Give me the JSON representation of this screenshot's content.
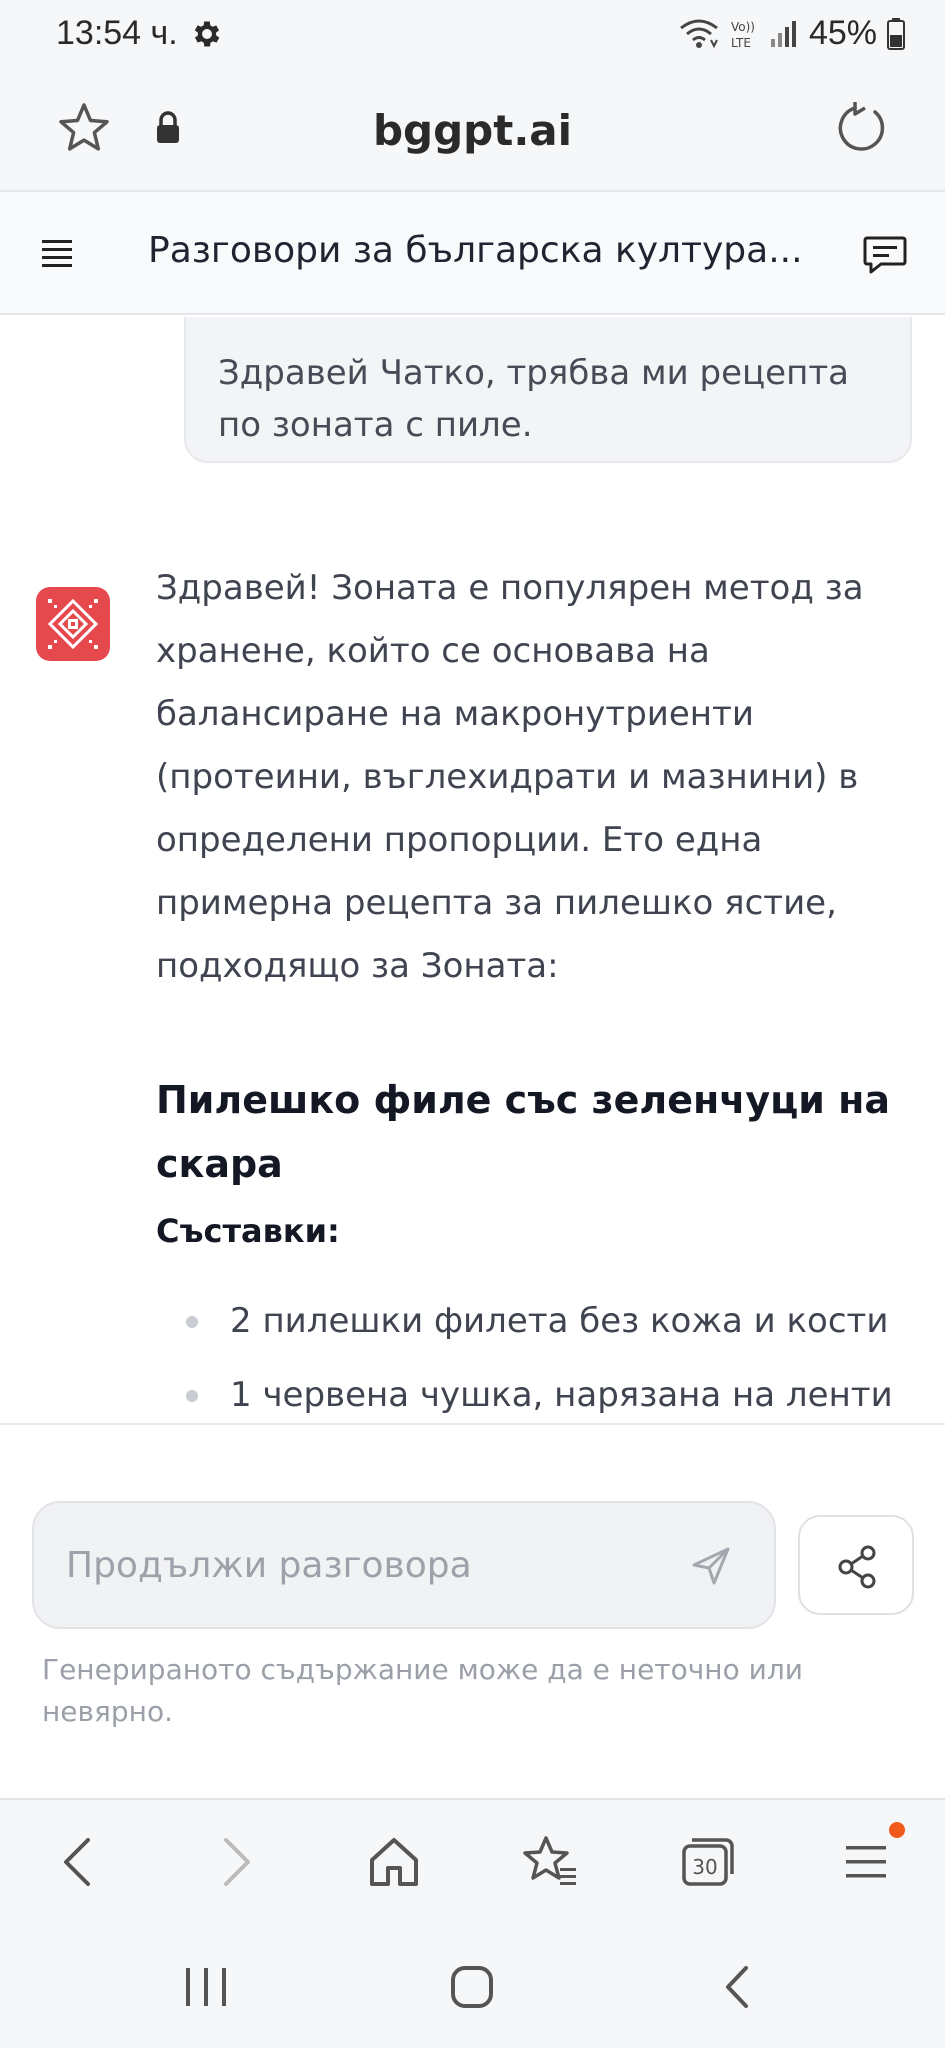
{
  "status_bar": {
    "time": "13:54 ч.",
    "battery": "45%",
    "icons": [
      "gear-icon",
      "wifi-icon",
      "volte-icon",
      "signal-icon",
      "battery-icon"
    ]
  },
  "address_bar": {
    "url": "bggpt.ai",
    "icons": [
      "star-icon",
      "lock-icon",
      "reload-icon"
    ]
  },
  "chat_header": {
    "title": "Разговори за българска култура...",
    "icons": [
      "menu-icon",
      "chat-icon"
    ]
  },
  "conversation": {
    "user_message": "Здравей Чатко,  трябва ми рецепта по зоната с пиле.",
    "assistant_intro": "Здравей! Зоната е популярен метод за хранене, който се основава на балансиране на макронутриенти (протеини, въглехидрати и мазнини) в определени пропорции. Ето една примерна рецепта за пилешко ястие, подходящо за Зоната:",
    "recipe_title": "Пилешко филе със зеленчуци на скара",
    "ingredients_label": "Съставки:",
    "ingredients": [
      "2 пилешки филета без кожа и кости",
      "1 червена чушка, нарязана на ленти"
    ]
  },
  "composer": {
    "placeholder": "Продължи разговора",
    "value": "",
    "disclaimer": "Генерираното съдържание може да е неточно или невярно."
  },
  "browser_nav": {
    "tabs_count": "30",
    "badge_color": "#f25a1b"
  },
  "colors": {
    "accent_red": "#e5484d",
    "bubble_bg": "#f3f4f6",
    "muted_text": "#9ba0a8"
  }
}
